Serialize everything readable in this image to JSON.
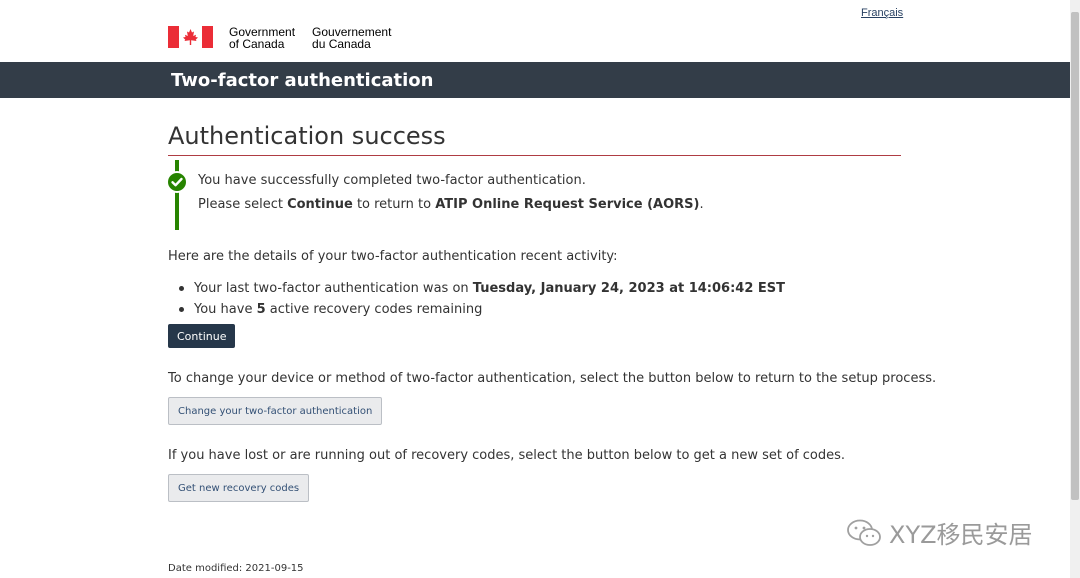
{
  "header": {
    "language_link": "Français",
    "signature_en": [
      "Government",
      "of Canada"
    ],
    "signature_fr": [
      "Gouvernement",
      "du Canada"
    ],
    "app_title": "Two-factor authentication"
  },
  "main": {
    "page_title": "Authentication success",
    "alert": {
      "line1": "You have successfully completed two-factor authentication.",
      "line2_prefix": "Please select ",
      "line2_bold1": "Continue",
      "line2_mid": " to return to ",
      "line2_bold2": "ATIP Online Request Service (AORS)",
      "line2_suffix": "."
    },
    "activity_intro": "Here are the details of your two-factor authentication recent activity:",
    "activity": {
      "last_prefix": "Your last two-factor authentication was on ",
      "last_datetime": "Tuesday, January 24, 2023 at 14:06:42 EST",
      "codes_prefix": "You have ",
      "codes_count": "5",
      "codes_suffix": " active recovery codes remaining"
    },
    "continue_label": "Continue",
    "change_text": "To change your device or method of two-factor authentication, select the button below to return to the setup process.",
    "change_button": "Change your two-factor authentication",
    "lost_text": "If you have lost or are running out of recovery codes, select the button below to get a new set of codes.",
    "recovery_button": "Get new recovery codes",
    "date_modified": "Date modified: 2021-09-15"
  },
  "watermark": "XYZ移民安居",
  "colors": {
    "title_bar": "#333d48",
    "success": "#278400",
    "primary_button": "#26374a",
    "title_rule": "#af3c43",
    "flag_red": "#eb2d37"
  }
}
